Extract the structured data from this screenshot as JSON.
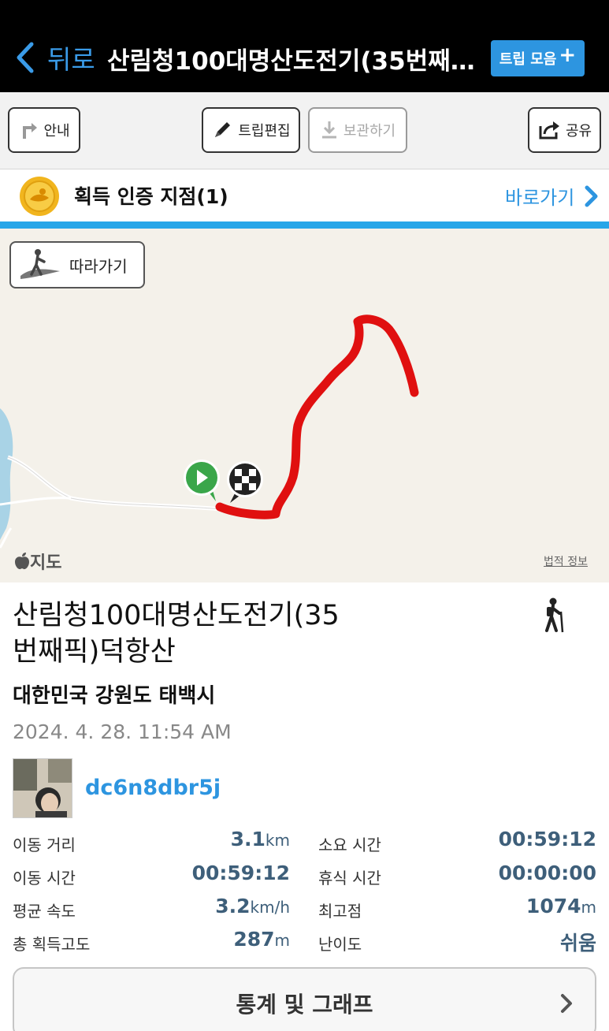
{
  "nav": {
    "back_label": "뒤로",
    "title": "산림청100대명산도전기(35번째…",
    "trip_collection_label": "트립 모음"
  },
  "toolbar": {
    "guide_label": "안내",
    "edit_label": "트립편집",
    "save_label": "보관하기",
    "share_label": "공유"
  },
  "cert": {
    "title": "획득 인증 지점(1)",
    "link_label": "바로가기"
  },
  "map": {
    "follow_label": "따라가기",
    "logo_label": "지도",
    "legal_label": "법적 정보"
  },
  "trip": {
    "title_line1": "산림청100대명산도전기(35",
    "title_line2": "번째픽)덕항산",
    "location": "대한민국 강원도 태백시",
    "datetime": "2024. 4. 28. 11:54 AM",
    "username": "dc6n8dbr5j"
  },
  "stats": {
    "distance_label": "이동 거리",
    "distance_value": "3.1",
    "distance_unit": "km",
    "total_time_label": "소요 시간",
    "total_time_value": "00:59:12",
    "moving_time_label": "이동 시간",
    "moving_time_value": "00:59:12",
    "rest_time_label": "휴식 시간",
    "rest_time_value": "00:00:00",
    "avg_speed_label": "평균 속도",
    "avg_speed_value": "3.2",
    "avg_speed_unit": "km/h",
    "max_alt_label": "최고점",
    "max_alt_value": "1074",
    "max_alt_unit": "m",
    "ascent_label": "총 획득고도",
    "ascent_value": "287",
    "ascent_unit": "m",
    "difficulty_label": "난이도",
    "difficulty_value": "쉬움"
  },
  "stats_button_label": "통계 및 그래프",
  "colors": {
    "accent": "#2d95e0",
    "track": "#e01010",
    "start_marker": "#3aa64a",
    "stat_value": "#3e5f7a"
  }
}
